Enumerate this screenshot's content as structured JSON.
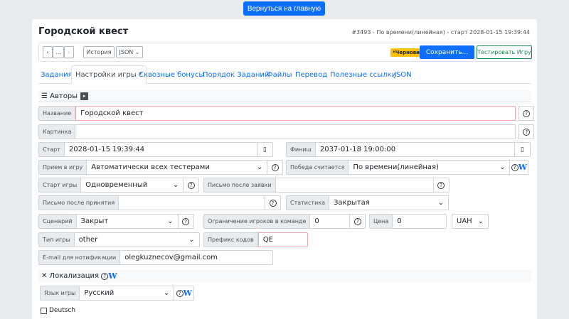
{
  "top": {
    "back_button": "Вернуться на главную"
  },
  "header": {
    "title": "Городской квест",
    "meta": "#3493 - По времени(линейная) - старт 2028-01-15 19:39:44"
  },
  "toolbar": {
    "undo": "‹",
    "ellipsis": "...",
    "redo": "›",
    "history": "История",
    "json": "JSON",
    "draft_badge": "*Черновик",
    "save": "Сохранить...",
    "test": "Тестировать Игру"
  },
  "tabs": [
    "Задания",
    "Настройки игры *",
    "Сквозные бонусы",
    "Порядок Заданий",
    "Файлы",
    "Перевод",
    "Полезные ссылки",
    "JSON"
  ],
  "authors": {
    "label": "☰ Авторы"
  },
  "fields": {
    "name": {
      "label": "Название",
      "value": "Городской квест"
    },
    "picture": {
      "label": "Картинка",
      "value": ""
    },
    "start": {
      "label": "Старт",
      "value": "2028-01-15 19:39:44"
    },
    "finish": {
      "label": "Финиш",
      "value": "2037-01-18 19:00:00"
    },
    "admission": {
      "label": "Прием в игру",
      "value": "Автоматически всех тестерами"
    },
    "victory": {
      "label": "Победа считается",
      "value": "По времени(линейная)"
    },
    "game_start": {
      "label": "Старт игры",
      "value": "Одновременный"
    },
    "letter_after_request": {
      "label": "Письмо после заявки",
      "value": ""
    },
    "letter_after_accept": {
      "label": "Письмо после принятия",
      "value": ""
    },
    "statistics": {
      "label": "Статистика",
      "value": "Закрытая"
    },
    "scenario": {
      "label": "Сценарий",
      "value": "Закрыт"
    },
    "team_limit": {
      "label": "Ограничение игроков в команде",
      "value": "0"
    },
    "price": {
      "label": "Цена",
      "value": "0"
    },
    "currency": {
      "value": "UAH"
    },
    "game_type": {
      "label": "Тип игры",
      "value": "other"
    },
    "code_prefix": {
      "label": "Префикс кодов",
      "value": "QE"
    },
    "email": {
      "label": "E-mail для нотификации",
      "value": "olegkuznecov@gmail.com"
    }
  },
  "localization": {
    "label": "✕ Локализация",
    "game_lang_label": "Язык игры",
    "game_lang_value": "Русский",
    "deutsch": "Deutsch"
  }
}
